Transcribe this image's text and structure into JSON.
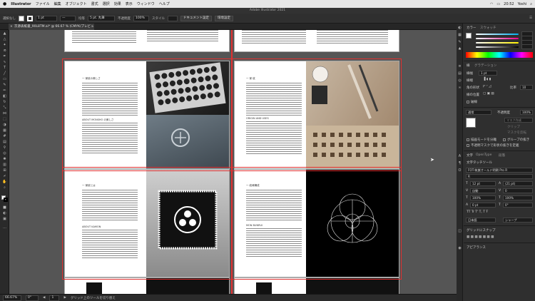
{
  "menubar": {
    "apple": "",
    "app": "Illustrator",
    "items": [
      "ファイル",
      "編集",
      "オブジェクト",
      "書式",
      "選択",
      "効果",
      "表示",
      "ウィンドウ",
      "ヘルプ"
    ],
    "clock": "20:52",
    "user": "Yoshi"
  },
  "window": {
    "title": "Adobe Illustrator 2021"
  },
  "control": {
    "selection": "選択なし",
    "stroke_weight": "1 pt",
    "uniform": "均等",
    "brush": "5 pt. 丸筆",
    "opacity_label": "不透明度",
    "opacity": "100%",
    "style_label": "スタイル",
    "doc_setup": "ドキュメント設定",
    "prefs": "環境設定"
  },
  "tab": {
    "label": "京源表紙書_90L8TM.ai* @ 66.67 % (CMYK/プレビュー)"
  },
  "status": {
    "zoom": "66.67%",
    "rotation": "0°",
    "artboard": "1",
    "tool": "グリッド上のツールを切り替え"
  },
  "pages": {
    "p1": {
      "heading": "一 家紋の美しさ",
      "sub": "ABOUT MONSHO の美しさ"
    },
    "p2": {
      "heading": "一 家 紋",
      "sub": "ORIGIN AND USES"
    },
    "p3": {
      "heading": "一 家紋とは",
      "sub": "ABOUT KAMON"
    },
    "p4": {
      "heading": "一 紋様構成",
      "sub": "MON BUNRUI"
    }
  },
  "panels": {
    "color": {
      "tab": "カラー",
      "tab2": "スウォッチ"
    },
    "stroke": {
      "tab": "線",
      "tab2": "グラデーション",
      "weight_label": "線幅",
      "weight": "1 pt",
      "cap_label": "線端",
      "corner_label": "角の形状",
      "limit_label": "比率",
      "limit": "10",
      "align_label": "線の位置",
      "dash_label": "破線"
    },
    "transparency": {
      "mode": "通常",
      "opacity_label": "不透明度",
      "opacity": "100%",
      "mask_btn": "マスク作成",
      "clip": "クリップ",
      "invert": "マスクを反転",
      "opt1": "描画モードを分離",
      "opt2": "グループの抜き",
      "opt3": "不透明マスクで形状の抜きを定義"
    },
    "character": {
      "tab": "文字",
      "tab2": "OpenType",
      "tab3": "段落",
      "touch": "文字タッチツール",
      "font": "FOT-筑紫オールド明朝 Pro R",
      "style": "R",
      "size": "12 pt",
      "leading": "(21 pt)",
      "kerning": "自動",
      "tracking": "0",
      "scale_v": "100%",
      "scale_h": "100%",
      "baseline": "0 pt",
      "rotate": "0°",
      "lang": "日本語",
      "aa": "シャープ"
    },
    "snap": {
      "tab": "グリッドにスナップ"
    },
    "appearance": {
      "tab": "アピアランス"
    }
  },
  "colors": {
    "accent": "#2d8ceb",
    "bleed": "#e03030"
  }
}
